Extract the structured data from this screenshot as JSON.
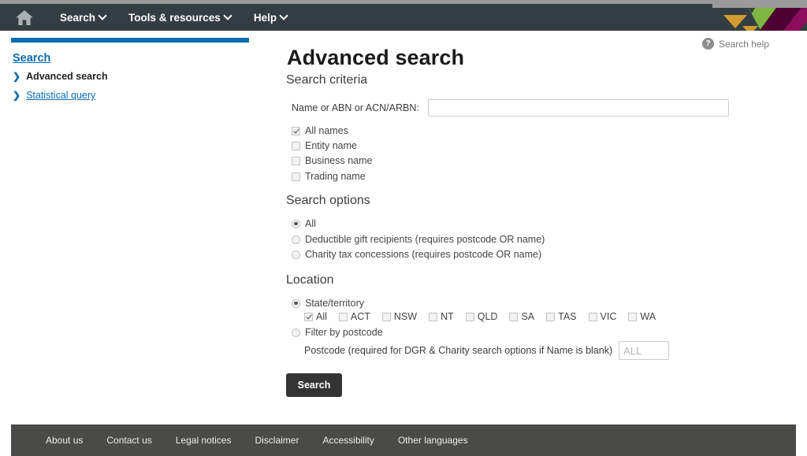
{
  "header": {
    "home_icon": "home-icon",
    "nav": [
      {
        "label": "Search",
        "caret": "chevron-down-icon"
      },
      {
        "label": "Tools & resources",
        "caret": "chevron-down-icon"
      },
      {
        "label": "Help",
        "caret": "chevron-down-icon"
      }
    ],
    "logo_colors": {
      "dark": "#333e42",
      "amber": "#d19b2e",
      "green": "#7fb541",
      "maroon": "#4d0033",
      "magenta": "#8b0d5c"
    }
  },
  "sidebar": {
    "heading": "Search",
    "items": [
      {
        "label": "Advanced search",
        "current": true
      },
      {
        "label": "Statistical query",
        "current": false
      }
    ]
  },
  "main": {
    "title": "Advanced search",
    "help": {
      "badge": "?",
      "label": "Search help"
    },
    "search_criteria": {
      "heading": "Search criteria",
      "name_label": "Name or ABN or ACN/ARBN:",
      "name_value": "",
      "name_placeholder": "",
      "name_options": [
        {
          "label": "All names",
          "checked": true
        },
        {
          "label": "Entity name",
          "checked": false
        },
        {
          "label": "Business name",
          "checked": false
        },
        {
          "label": "Trading name",
          "checked": false
        }
      ]
    },
    "search_options": {
      "heading": "Search options",
      "options": [
        {
          "label": "All",
          "selected": true
        },
        {
          "label": "Deductible gift recipients (requires postcode OR name)",
          "selected": false
        },
        {
          "label": "Charity tax concessions (requires postcode OR name)",
          "selected": false
        }
      ]
    },
    "location": {
      "heading": "Location",
      "mode_state_label": "State/territory",
      "mode_state_selected": true,
      "states": [
        {
          "label": "All",
          "checked": true
        },
        {
          "label": "ACT",
          "checked": false
        },
        {
          "label": "NSW",
          "checked": false
        },
        {
          "label": "NT",
          "checked": false
        },
        {
          "label": "QLD",
          "checked": false
        },
        {
          "label": "SA",
          "checked": false
        },
        {
          "label": "TAS",
          "checked": false
        },
        {
          "label": "VIC",
          "checked": false
        },
        {
          "label": "WA",
          "checked": false
        }
      ],
      "mode_postcode_label": "Filter by postcode",
      "mode_postcode_selected": false,
      "postcode_label": "Postcode (required for DGR & Charity search options if Name is blank)",
      "postcode_value": "",
      "postcode_placeholder": "ALL"
    },
    "submit_label": "Search"
  },
  "footer": {
    "links": [
      "About us",
      "Contact us",
      "Legal notices",
      "Disclaimer",
      "Accessibility",
      "Other languages"
    ]
  }
}
